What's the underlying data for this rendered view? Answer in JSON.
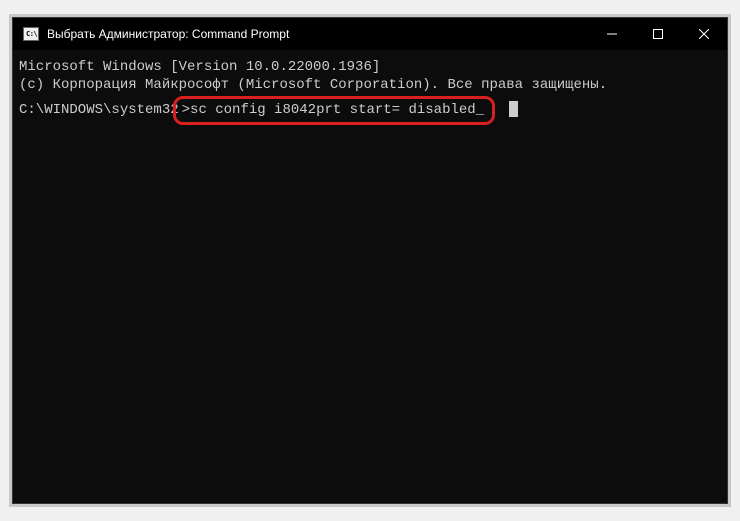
{
  "window": {
    "title": "Выбрать Администратор: Command Prompt",
    "iconText": "C:\\"
  },
  "terminal": {
    "line1": "Microsoft Windows [Version 10.0.22000.1936]",
    "line2": "(c) Корпорация Майкрософт (Microsoft Corporation). Все права защищены.",
    "blank": "",
    "promptPath": "C:\\WINDOWS\\system32",
    "promptChar": ">",
    "command": "sc config i8042prt start= disabled",
    "cursorChar": "_"
  }
}
